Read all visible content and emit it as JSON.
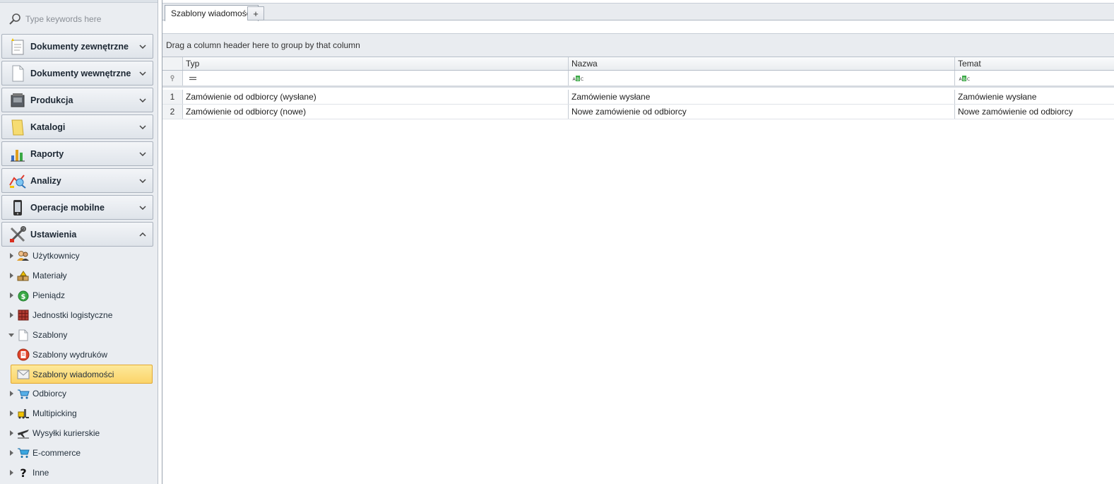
{
  "search": {
    "placeholder": "Type keywords here"
  },
  "sidebar": {
    "groups": [
      {
        "label": "Dokumenty zewnętrzne",
        "icon": "external-documents-icon",
        "expanded": false
      },
      {
        "label": "Dokumenty wewnętrzne",
        "icon": "internal-documents-icon",
        "expanded": false
      },
      {
        "label": "Produkcja",
        "icon": "production-icon",
        "expanded": false
      },
      {
        "label": "Katalogi",
        "icon": "catalog-icon",
        "expanded": false
      },
      {
        "label": "Raporty",
        "icon": "reports-icon",
        "expanded": false
      },
      {
        "label": "Analizy",
        "icon": "analysis-icon",
        "expanded": false
      },
      {
        "label": "Operacje mobilne",
        "icon": "mobile-icon",
        "expanded": false
      },
      {
        "label": "Ustawienia",
        "icon": "settings-tools-icon",
        "expanded": true
      }
    ],
    "settings_items": [
      {
        "label": "Użytkownicy",
        "icon": "users-icon"
      },
      {
        "label": "Materiały",
        "icon": "materials-icon"
      },
      {
        "label": "Pieniądz",
        "icon": "money-icon"
      },
      {
        "label": "Jednostki logistyczne",
        "icon": "logistics-units-icon"
      },
      {
        "label": "Szablony",
        "icon": "templates-icon"
      },
      {
        "label": "Szablony wydruków",
        "icon": "print-templates-icon"
      },
      {
        "label": "Szablony wiadomości",
        "icon": "message-templates-icon"
      },
      {
        "label": "Odbiorcy",
        "icon": "recipients-icon"
      },
      {
        "label": "Multipicking",
        "icon": "multipicking-icon"
      },
      {
        "label": "Wysyłki kurierskie",
        "icon": "courier-icon"
      },
      {
        "label": "E-commerce",
        "icon": "cart-icon"
      },
      {
        "label": "Inne",
        "icon": "question-icon"
      }
    ]
  },
  "tabs": {
    "active_label": "Szablony wiadomości",
    "add_label": "+"
  },
  "grid": {
    "group_panel_text": "Drag a column header here to group by that column",
    "columns": [
      "Typ",
      "Nazwa",
      "Temat"
    ],
    "rows": [
      {
        "num": "1",
        "typ": "Zamówienie od odbiorcy (wysłane)",
        "nazwa": "Zamówienie wysłane",
        "temat": "Zamówienie wysłane"
      },
      {
        "num": "2",
        "typ": "Zamówienie od odbiorcy (nowe)",
        "nazwa": "Nowe zamówienie od odbiorcy",
        "temat": "Nowe zamówienie od odbiorcy"
      }
    ]
  },
  "colors": {
    "selection": "#fbd46a",
    "selection_border": "#e2a830",
    "sidebar_bg": "#eaedf1",
    "abc_green": "#3aa845"
  }
}
